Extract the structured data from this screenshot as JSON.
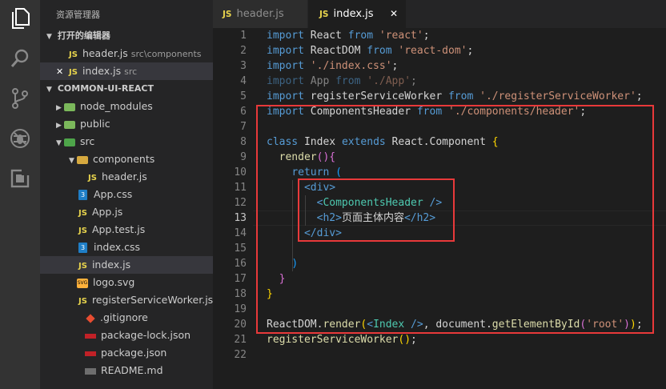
{
  "activity_bar": {
    "icons": [
      "explorer-icon",
      "search-icon",
      "source-control-icon",
      "debug-icon",
      "extensions-icon"
    ]
  },
  "sidebar": {
    "title": "资源管理器",
    "open_editors_title": "打开的编辑器",
    "open_editors": [
      {
        "badge": "JS",
        "name": "header.js",
        "path": "src\\components"
      },
      {
        "badge": "JS",
        "name": "index.js",
        "path": "src",
        "close": "✕"
      }
    ],
    "project_title": "COMMON-UI-REACT",
    "tree": [
      {
        "name": "node_modules"
      },
      {
        "name": "public"
      },
      {
        "name": "src"
      },
      {
        "name": "components"
      },
      {
        "name": "header.js",
        "badge": "JS"
      },
      {
        "name": "App.css",
        "badge": "3"
      },
      {
        "name": "App.js",
        "badge": "JS"
      },
      {
        "name": "App.test.js",
        "badge": "JS"
      },
      {
        "name": "index.css",
        "badge": "3"
      },
      {
        "name": "index.js",
        "badge": "JS"
      },
      {
        "name": "logo.svg",
        "badge": "SVG"
      },
      {
        "name": "registerServiceWorker.js",
        "badge": "JS"
      },
      {
        "name": ".gitignore"
      },
      {
        "name": "package-lock.json"
      },
      {
        "name": "package.json"
      },
      {
        "name": "README.md"
      }
    ]
  },
  "tabs": [
    {
      "badge": "JS",
      "label": "header.js",
      "active": false
    },
    {
      "badge": "JS",
      "label": "index.js",
      "active": true,
      "close": "✕"
    }
  ],
  "editor": {
    "current_line": 13,
    "line_numbers": [
      "1",
      "2",
      "3",
      "4",
      "5",
      "6",
      "7",
      "8",
      "9",
      "10",
      "11",
      "12",
      "13",
      "14",
      "15",
      "16",
      "17",
      "18",
      "19",
      "20",
      "21",
      "22"
    ],
    "lines": [
      [
        [
          "kw",
          "import"
        ],
        [
          "id",
          " React "
        ],
        [
          "kw",
          "from"
        ],
        [
          "str",
          " 'react'"
        ],
        [
          "id",
          ";"
        ]
      ],
      [
        [
          "kw",
          "import"
        ],
        [
          "id",
          " ReactDOM "
        ],
        [
          "kw",
          "from"
        ],
        [
          "str",
          " 'react-dom'"
        ],
        [
          "id",
          ";"
        ]
      ],
      [
        [
          "kw",
          "import"
        ],
        [
          "str",
          " './index.css'"
        ],
        [
          "id",
          ";"
        ]
      ],
      [
        [
          "kw dim",
          "import"
        ],
        [
          "id dim",
          " App "
        ],
        [
          "kw dim",
          "from"
        ],
        [
          "str dim",
          " './App'"
        ],
        [
          "id dim",
          ";"
        ]
      ],
      [
        [
          "kw",
          "import"
        ],
        [
          "id",
          " registerServiceWorker "
        ],
        [
          "kw",
          "from"
        ],
        [
          "str",
          " './registerServiceWorker'"
        ],
        [
          "id",
          ";"
        ]
      ],
      [
        [
          "kw",
          "import"
        ],
        [
          "id",
          " ComponentsHeader "
        ],
        [
          "kw",
          "from"
        ],
        [
          "str",
          " './components/header'"
        ],
        [
          "id",
          ";"
        ]
      ],
      [],
      [
        [
          "kw",
          "class"
        ],
        [
          "id",
          " Index "
        ],
        [
          "kw",
          "extends"
        ],
        [
          "id",
          " React.Component "
        ],
        [
          "brace",
          "{"
        ]
      ],
      [
        [
          "id",
          "  "
        ],
        [
          "fn",
          "render"
        ],
        [
          "br2",
          "()"
        ],
        [
          "br2",
          "{"
        ]
      ],
      [
        [
          "id",
          "    "
        ],
        [
          "kw",
          "return"
        ],
        [
          "br3",
          " ("
        ]
      ],
      [
        [
          "id",
          "      "
        ],
        [
          "tag",
          "<div>"
        ]
      ],
      [
        [
          "id",
          "        "
        ],
        [
          "tag",
          "<"
        ],
        [
          "comp",
          "ComponentsHeader"
        ],
        [
          "tag",
          " />"
        ]
      ],
      [
        [
          "id",
          "        "
        ],
        [
          "tag",
          "<h2>"
        ],
        [
          "id",
          "页面主体内容"
        ],
        [
          "tag",
          "</h2>"
        ]
      ],
      [
        [
          "id",
          "      "
        ],
        [
          "tag",
          "</div>"
        ]
      ],
      [],
      [
        [
          "id",
          "    "
        ],
        [
          "br3",
          ")"
        ]
      ],
      [
        [
          "id",
          "  "
        ],
        [
          "br2",
          "}"
        ]
      ],
      [
        [
          "brace",
          "}"
        ]
      ],
      [],
      [
        [
          "id",
          "ReactDOM."
        ],
        [
          "fn",
          "render"
        ],
        [
          "brace",
          "("
        ],
        [
          "tag",
          "<"
        ],
        [
          "comp",
          "Index"
        ],
        [
          "tag",
          " />"
        ],
        [
          "id",
          ", document."
        ],
        [
          "fn",
          "getElementById"
        ],
        [
          "br2",
          "("
        ],
        [
          "str",
          "'root'"
        ],
        [
          "br2",
          ")"
        ],
        [
          "brace",
          ")"
        ],
        [
          "id",
          ";"
        ]
      ],
      [
        [
          "fn",
          "registerServiceWorker"
        ],
        [
          "brace",
          "()"
        ],
        [
          "id",
          ";"
        ]
      ],
      []
    ]
  },
  "colors": {
    "highlight_box": "#e8393a",
    "activity_bar": "#333333",
    "sidebar": "#252526",
    "editor_bg": "#1e1e1e"
  }
}
